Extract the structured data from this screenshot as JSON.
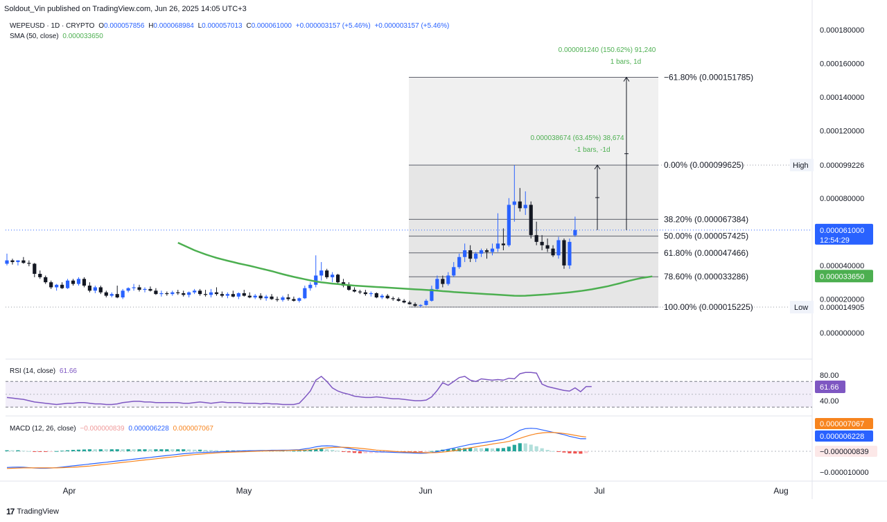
{
  "header": {
    "attribution": "Soldout_Vin published on TradingView.com, Jun 26, 2025 14:05 UTC+3"
  },
  "legend": {
    "symbol": "WEPEUSD · 1D · CRYPTO",
    "open_label": "O",
    "open": "0.000057856",
    "high_label": "H",
    "high": "0.000068984",
    "low_label": "L",
    "low": "0.000057013",
    "close_label": "C",
    "close": "0.000061000",
    "change": "+0.000003157 (+5.46%)",
    "change2": "+0.000003157 (+5.46%)",
    "sma_label": "SMA (50, close)",
    "sma_value": "0.000033650",
    "rsi_label": "RSI (14, close)",
    "rsi_value": "61.66",
    "macd_label": "MACD (12, 26, close)",
    "macd_hist": "−0.000000839",
    "macd_line": "0.000006228",
    "macd_signal": "0.000007067"
  },
  "colors": {
    "up": "#2962ff",
    "down": "#131722",
    "sma": "#4caf50",
    "macd": "#2962ff",
    "signal": "#f7841e",
    "rsi": "#7e57c2",
    "current": "#2962ff",
    "fib_box": "#d1d4dc"
  },
  "brand": {
    "name": "TradingView",
    "logo": "icon-tradingview-logo"
  },
  "chart_data": {
    "type": "candlestick",
    "price_axis": {
      "labels": [
        "0.000180000",
        "0.000160000",
        "0.000140000",
        "0.000120000",
        "0.000080000",
        "0.000040000",
        "0.000020000",
        "0.000000000"
      ],
      "range": [
        0,
        0.00019
      ]
    },
    "time_axis": {
      "labels": [
        "Apr",
        "May",
        "Jun",
        "Jul",
        "Aug"
      ]
    },
    "candles": [
      [
        4.1e-05,
        4.7e-05,
        4e-05,
        4.3e-05
      ],
      [
        4.3e-05,
        4.4e-05,
        4.05e-05,
        4.2e-05
      ],
      [
        4.2e-05,
        4.3e-05,
        4e-05,
        4.3e-05
      ],
      [
        4.3e-05,
        4.5e-05,
        4.1e-05,
        4.15e-05
      ],
      [
        4.15e-05,
        4.3e-05,
        3.95e-05,
        4.1e-05
      ],
      [
        4.1e-05,
        4.15e-05,
        3.3e-05,
        3.5e-05
      ],
      [
        3.5e-05,
        3.7e-05,
        3.2e-05,
        3.3e-05
      ],
      [
        3.3e-05,
        3.4e-05,
        2.9e-05,
        3e-05
      ],
      [
        3e-05,
        3.1e-05,
        2.6e-05,
        2.7e-05
      ],
      [
        2.7e-05,
        2.9e-05,
        2.5e-05,
        2.85e-05
      ],
      [
        2.85e-05,
        3e-05,
        2.6e-05,
        2.65e-05
      ],
      [
        2.65e-05,
        3.2e-05,
        2.6e-05,
        3.1e-05
      ],
      [
        3.1e-05,
        3.2e-05,
        2.8e-05,
        2.9e-05
      ],
      [
        2.9e-05,
        3.3e-05,
        2.8e-05,
        3.2e-05
      ],
      [
        3.2e-05,
        3.3e-05,
        2.7e-05,
        2.8e-05
      ],
      [
        2.8e-05,
        3e-05,
        2.4e-05,
        2.5e-05
      ],
      [
        2.5e-05,
        2.8e-05,
        2.35e-05,
        2.7e-05
      ],
      [
        2.7e-05,
        2.8e-05,
        2.3e-05,
        2.4e-05
      ],
      [
        2.4e-05,
        2.5e-05,
        2.1e-05,
        2.2e-05
      ],
      [
        2.2e-05,
        2.4e-05,
        2.1e-05,
        2.3e-05
      ],
      [
        2.3e-05,
        2.8e-05,
        2.05e-05,
        2.1e-05
      ],
      [
        2.1e-05,
        2.6e-05,
        2e-05,
        2.5e-05
      ],
      [
        2.5e-05,
        2.7e-05,
        2.4e-05,
        2.65e-05
      ],
      [
        2.65e-05,
        2.9e-05,
        2.5e-05,
        2.7e-05
      ],
      [
        2.7e-05,
        2.85e-05,
        2.45e-05,
        2.55e-05
      ],
      [
        2.55e-05,
        2.7e-05,
        2.4e-05,
        2.6e-05
      ],
      [
        2.6e-05,
        2.75e-05,
        2.45e-05,
        2.5e-05
      ],
      [
        2.5e-05,
        2.65e-05,
        2.25e-05,
        2.3e-05
      ],
      [
        2.3e-05,
        2.5e-05,
        2.15e-05,
        2.35e-05
      ],
      [
        2.35e-05,
        2.45e-05,
        2.2e-05,
        2.3e-05
      ],
      [
        2.3e-05,
        2.5e-05,
        2.2e-05,
        2.4e-05
      ],
      [
        2.4e-05,
        2.55e-05,
        2.25e-05,
        2.35e-05
      ],
      [
        2.35e-05,
        2.5e-05,
        2.15e-05,
        2.25e-05
      ],
      [
        2.25e-05,
        2.45e-05,
        2.1e-05,
        2.4e-05
      ],
      [
        2.4e-05,
        2.6e-05,
        2.3e-05,
        2.5e-05
      ],
      [
        2.5e-05,
        2.6e-05,
        2.2e-05,
        2.3e-05
      ],
      [
        2.3e-05,
        2.55e-05,
        2.15e-05,
        2.25e-05
      ],
      [
        2.25e-05,
        2.6e-05,
        2.1e-05,
        2.4e-05
      ],
      [
        2.4e-05,
        2.7e-05,
        2.2e-05,
        2.3e-05
      ],
      [
        2.3e-05,
        2.45e-05,
        2.1e-05,
        2.2e-05
      ],
      [
        2.2e-05,
        2.4e-05,
        2.05e-05,
        2.3e-05
      ],
      [
        2.3e-05,
        2.5e-05,
        2.1e-05,
        2.15e-05
      ],
      [
        2.15e-05,
        2.4e-05,
        2e-05,
        2.35e-05
      ],
      [
        2.35e-05,
        2.55e-05,
        2.15e-05,
        2.2e-05
      ],
      [
        2.2e-05,
        2.4e-05,
        2.05e-05,
        2.1e-05
      ],
      [
        2.1e-05,
        2.3e-05,
        2e-05,
        2.2e-05
      ],
      [
        2.2e-05,
        2.35e-05,
        1.95e-05,
        2.05e-05
      ],
      [
        2.05e-05,
        2.25e-05,
        1.9e-05,
        2.15e-05
      ],
      [
        2.15e-05,
        2.3e-05,
        1.95e-05,
        2e-05
      ],
      [
        2e-05,
        2.15e-05,
        1.85e-05,
        1.95e-05
      ],
      [
        1.95e-05,
        2.2e-05,
        1.85e-05,
        2.1e-05
      ],
      [
        2.1e-05,
        2.3e-05,
        1.9e-05,
        2e-05
      ],
      [
        2e-05,
        2.15e-05,
        1.85e-05,
        1.9e-05
      ],
      [
        1.9e-05,
        2.1e-05,
        1.8e-05,
        2.05e-05
      ],
      [
        2.05e-05,
        2.8e-05,
        2e-05,
        2.65e-05
      ],
      [
        2.65e-05,
        3e-05,
        2.5e-05,
        2.85e-05
      ],
      [
        2.85e-05,
        4.6e-05,
        2.7e-05,
        3.4e-05
      ],
      [
        3.4e-05,
        4.2e-05,
        3.1e-05,
        3.7e-05
      ],
      [
        3.7e-05,
        3.8e-05,
        3.2e-05,
        3.3e-05
      ],
      [
        3.3e-05,
        3.6e-05,
        3e-05,
        3.45e-05
      ],
      [
        3.45e-05,
        3.5e-05,
        2.9e-05,
        3e-05
      ],
      [
        3e-05,
        3.2e-05,
        2.7e-05,
        2.8e-05
      ],
      [
        2.8e-05,
        3e-05,
        2.5e-05,
        2.55e-05
      ],
      [
        2.55e-05,
        2.7e-05,
        2.4e-05,
        2.45e-05
      ],
      [
        2.45e-05,
        2.55e-05,
        2.3e-05,
        2.4e-05
      ],
      [
        2.4e-05,
        2.55e-05,
        2.2e-05,
        2.3e-05
      ],
      [
        2.3e-05,
        2.45e-05,
        2.15e-05,
        2.35e-05
      ],
      [
        2.35e-05,
        2.4e-05,
        2.05e-05,
        2.1e-05
      ],
      [
        2.1e-05,
        2.3e-05,
        2e-05,
        2.2e-05
      ],
      [
        2.2e-05,
        2.3e-05,
        2e-05,
        2.05e-05
      ],
      [
        2.05e-05,
        2.15e-05,
        1.9e-05,
        2e-05
      ],
      [
        2e-05,
        2.1e-05,
        1.85e-05,
        1.9e-05
      ],
      [
        1.9e-05,
        2e-05,
        1.75e-05,
        1.8e-05
      ],
      [
        1.8e-05,
        1.9e-05,
        1.68e-05,
        1.7e-05
      ],
      [
        1.7e-05,
        1.8e-05,
        1.55e-05,
        1.6e-05
      ],
      [
        1.6e-05,
        1.7e-05,
        1.5e-05,
        1.65e-05
      ],
      [
        1.65e-05,
        2e-05,
        1.6e-05,
        1.9e-05
      ],
      [
        1.9e-05,
        2.8e-05,
        1.85e-05,
        2.6e-05
      ],
      [
        2.6e-05,
        3.4e-05,
        2.5e-05,
        3.2e-05
      ],
      [
        3.2e-05,
        3.4e-05,
        2.7e-05,
        2.9e-05
      ],
      [
        2.9e-05,
        3.6e-05,
        2.8e-05,
        3.4e-05
      ],
      [
        3.4e-05,
        4.2e-05,
        3.3e-05,
        3.9e-05
      ],
      [
        3.9e-05,
        4.7e-05,
        3.8e-05,
        4.5e-05
      ],
      [
        4.5e-05,
        5.3e-05,
        4.2e-05,
        4.9e-05
      ],
      [
        4.9e-05,
        5.2e-05,
        4.2e-05,
        4.4e-05
      ],
      [
        4.4e-05,
        4.8e-05,
        4.2e-05,
        4.7e-05
      ],
      [
        4.7e-05,
        5e-05,
        4.5e-05,
        4.9e-05
      ],
      [
        4.9e-05,
        5e-05,
        4.4e-05,
        4.8e-05
      ],
      [
        4.8e-05,
        5.3e-05,
        4.6e-05,
        5e-05
      ],
      [
        5e-05,
        7.1e-05,
        4.8e-05,
        5.3e-05
      ],
      [
        5.3e-05,
        6.2e-05,
        4.9e-05,
        5.2e-05
      ],
      [
        5.2e-05,
        8e-05,
        5.1e-05,
        7.6e-05
      ],
      [
        7.6e-05,
        9.96e-05,
        6.6e-05,
        7.8e-05
      ],
      [
        7.8e-05,
        8.6e-05,
        7.2e-05,
        7.4e-05
      ],
      [
        7.4e-05,
        8.4e-05,
        7e-05,
        7.6e-05
      ],
      [
        7.6e-05,
        7.8e-05,
        5.6e-05,
        5.8e-05
      ],
      [
        5.8e-05,
        6.6e-05,
        5.2e-05,
        5.4e-05
      ],
      [
        5.4e-05,
        5.8e-05,
        4.9e-05,
        5.2e-05
      ],
      [
        5.2e-05,
        5.6e-05,
        4.8e-05,
        5e-05
      ],
      [
        5e-05,
        5.2e-05,
        4.5e-05,
        4.6e-05
      ],
      [
        4.6e-05,
        5.7e-05,
        4.4e-05,
        5.5e-05
      ],
      [
        5.5e-05,
        5.6e-05,
        3.8e-05,
        4e-05
      ],
      [
        4e-05,
        5.6e-05,
        3.8e-05,
        5.4e-05
      ],
      [
        5.79e-05,
        6.9e-05,
        5.7e-05,
        6.1e-05
      ]
    ],
    "sma": {
      "name": "SMA (50, close)",
      "start_index": 31,
      "values": [
        5.35e-05,
        5.2e-05,
        5.05e-05,
        4.9e-05,
        4.78e-05,
        4.66e-05,
        4.55e-05,
        4.45e-05,
        4.36e-05,
        4.28e-05,
        4.2e-05,
        4.12e-05,
        4.05e-05,
        3.98e-05,
        3.9e-05,
        3.82e-05,
        3.74e-05,
        3.66e-05,
        3.57e-05,
        3.48e-05,
        3.4e-05,
        3.32e-05,
        3.25e-05,
        3.18e-05,
        3.11e-05,
        3.05e-05,
        3e-05,
        2.96e-05,
        2.92e-05,
        2.89e-05,
        2.86e-05,
        2.83e-05,
        2.8e-05,
        2.78e-05,
        2.76e-05,
        2.74e-05,
        2.72e-05,
        2.7e-05,
        2.68e-05,
        2.66e-05,
        2.64e-05,
        2.62e-05,
        2.6e-05,
        2.58e-05,
        2.56e-05,
        2.54e-05,
        2.52e-05,
        2.5e-05,
        2.47e-05,
        2.45e-05,
        2.42e-05,
        2.4e-05,
        2.38e-05,
        2.36e-05,
        2.34e-05,
        2.32e-05,
        2.3e-05,
        2.28e-05,
        2.26e-05,
        2.24e-05,
        2.22e-05,
        2.2e-05,
        2.19e-05,
        2.2e-05,
        2.22e-05,
        2.24e-05,
        2.26e-05,
        2.28e-05,
        2.31e-05,
        2.34e-05,
        2.37e-05,
        2.4e-05,
        2.44e-05,
        2.48e-05,
        2.53e-05,
        2.58e-05,
        2.64e-05,
        2.7e-05,
        2.77e-05,
        2.85e-05,
        2.93e-05,
        3.02e-05,
        3.1e-05,
        3.18e-05,
        3.25e-05,
        3.3e-05,
        3.35e-05
      ]
    },
    "fib_levels": [
      {
        "label": "−61.80% (0.000151785)",
        "value": 0.000151785
      },
      {
        "label": "0.00% (0.000099625)",
        "value": 9.9625e-05
      },
      {
        "label": "38.20% (0.000067384)",
        "value": 6.7384e-05
      },
      {
        "label": "50.00% (0.000057425)",
        "value": 5.7425e-05
      },
      {
        "label": "61.80% (0.000047466)",
        "value": 4.7466e-05
      },
      {
        "label": "78.60% (0.000033286)",
        "value": 3.3286e-05
      },
      {
        "label": "100.00% (0.000015225)",
        "value": 1.5225e-05
      }
    ],
    "measures": [
      {
        "line1": "0.000091240 (150.62%) 91,240",
        "line2": "1 bars, 1d",
        "from": 6.1e-05,
        "to": 0.000151785
      },
      {
        "line1": "0.000038674 (63.45%) 38,674",
        "line2": "-1 bars, -1d",
        "from": 6.1e-05,
        "to": 9.9625e-05
      }
    ],
    "price_tags": {
      "high_label": "High",
      "high_value": "0.000099226",
      "high": 9.9625e-05,
      "low_label": "Low",
      "low_value": "0.000014905",
      "low": 1.5225e-05,
      "current_value": "0.000061000",
      "current": 6.1e-05,
      "countdown": "12:54:29",
      "sma_value": "0.000033650",
      "sma": 3.365e-05
    },
    "rsi": {
      "axis_labels": [
        "80.00",
        "40.00"
      ],
      "upper": 70,
      "lower": 30,
      "value_label": "61.66",
      "values": [
        45,
        44,
        43,
        42,
        40,
        38,
        37,
        36,
        35,
        34,
        35,
        36,
        36,
        37,
        37,
        36,
        35,
        35,
        34,
        34,
        35,
        37,
        38,
        39,
        39,
        38,
        38,
        37,
        37,
        37,
        37,
        37,
        36,
        36,
        37,
        38,
        37,
        36,
        37,
        38,
        37,
        37,
        37,
        36,
        36,
        36,
        35,
        36,
        35,
        35,
        34,
        34,
        34,
        36,
        45,
        55,
        72,
        78,
        70,
        60,
        55,
        52,
        50,
        47,
        46,
        45,
        45,
        46,
        45,
        44,
        43,
        43,
        42,
        41,
        40,
        40,
        41,
        46,
        56,
        68,
        64,
        70,
        76,
        78,
        72,
        70,
        74,
        73,
        72,
        73,
        72,
        75,
        74,
        82,
        84,
        84,
        83,
        66,
        62,
        60,
        58,
        56,
        55,
        60,
        54,
        62,
        62
      ]
    },
    "macd": {
      "axis_labels": [
        "−0.000010000"
      ],
      "macd_label": "0.000006228",
      "signal_label": "0.000007067",
      "hist_label": "−0.000000839",
      "macd": [
        -8e-06,
        -7.9e-06,
        -7.8e-06,
        -7.9e-06,
        -8.1e-06,
        -8.3e-06,
        -8.4e-06,
        -8.4e-06,
        -8.3e-06,
        -8.1e-06,
        -7.8e-06,
        -7.5e-06,
        -7.2e-06,
        -6.9e-06,
        -6.6e-06,
        -6.3e-06,
        -6e-06,
        -5.7e-06,
        -5.4e-06,
        -5.1e-06,
        -4.8e-06,
        -4.5e-06,
        -4.2e-06,
        -3.9e-06,
        -3.6e-06,
        -3.3e-06,
        -3e-06,
        -2.7e-06,
        -2.4e-06,
        -2.1e-06,
        -1.8e-06,
        -1.5e-06,
        -1.2e-06,
        -1e-06,
        -8e-07,
        -6e-07,
        -5e-07,
        -4e-07,
        -3e-07,
        -2e-07,
        -1e-07,
        0.0,
        1e-07,
        2e-07,
        3e-07,
        3e-07,
        4e-07,
        4e-07,
        5e-07,
        5e-07,
        6e-07,
        6e-07,
        7e-07,
        8e-07,
        1.2e-06,
        1.6e-06,
        2.2e-06,
        2.6e-06,
        2.7e-06,
        2.6e-06,
        2.3e-06,
        1.9e-06,
        1.4e-06,
        9e-07,
        5e-07,
        2e-07,
        0.0,
        -2e-07,
        -3e-07,
        -4e-07,
        -5e-07,
        -6e-07,
        -7e-07,
        -8e-07,
        -9e-07,
        -1e-06,
        -9e-07,
        -6e-07,
        -2e-07,
        4e-07,
        1e-06,
        1.6e-06,
        2.2e-06,
        2.8e-06,
        3.4e-06,
        3.8e-06,
        4.2e-06,
        4.6e-06,
        5e-06,
        5.5e-06,
        6e-06,
        7.2e-06,
        8.8e-06,
        1.04e-05,
        1.12e-05,
        1.14e-05,
        1.12e-05,
        1.06e-05,
        1e-05,
        9.4e-06,
        8.8e-06,
        8.2e-06,
        7.4e-06,
        6.8e-06,
        6.2e-06,
        6.2e-06
      ],
      "signal": [
        -8.5e-06,
        -8.4e-06,
        -8.3e-06,
        -8.2e-06,
        -8.2e-06,
        -8.2e-06,
        -8.2e-06,
        -8.2e-06,
        -8.2e-06,
        -8.2e-06,
        -8.1e-06,
        -8e-06,
        -7.9e-06,
        -7.7e-06,
        -7.5e-06,
        -7.3e-06,
        -7e-06,
        -6.7e-06,
        -6.4e-06,
        -6.1e-06,
        -5.8e-06,
        -5.5e-06,
        -5.2e-06,
        -4.9e-06,
        -4.6e-06,
        -4.3e-06,
        -4e-06,
        -3.7e-06,
        -3.4e-06,
        -3.1e-06,
        -2.8e-06,
        -2.5e-06,
        -2.2e-06,
        -1.9e-06,
        -1.6e-06,
        -1.4e-06,
        -1.2e-06,
        -1e-06,
        -8e-07,
        -6e-07,
        -5e-07,
        -4e-07,
        -3e-07,
        -2e-07,
        -1e-07,
        0.0,
        1e-07,
        2e-07,
        2e-07,
        3e-07,
        3e-07,
        4e-07,
        5e-07,
        5e-07,
        6e-07,
        8e-07,
        1.1e-06,
        1.4e-06,
        1.7e-06,
        1.9e-06,
        2e-06,
        2e-06,
        1.9e-06,
        1.7e-06,
        1.5e-06,
        1.2e-06,
        9e-07,
        6e-07,
        4e-07,
        2e-07,
        0.0,
        -2e-07,
        -3e-07,
        -4e-07,
        -5e-07,
        -6e-07,
        -7e-07,
        -7e-07,
        -6e-07,
        -4e-07,
        -1e-07,
        3e-07,
        7e-07,
        1.2e-06,
        1.7e-06,
        2.2e-06,
        2.7e-06,
        3.1e-06,
        3.6e-06,
        4e-06,
        4.4e-06,
        4.9e-06,
        5.6e-06,
        6.4e-06,
        7.3e-06,
        8.1e-06,
        8.7e-06,
        9.1e-06,
        9.3e-06,
        9.3e-06,
        9.1e-06,
        8.8e-06,
        8.4e-06,
        7.9e-06,
        7.4e-06,
        7.1e-06
      ]
    }
  }
}
